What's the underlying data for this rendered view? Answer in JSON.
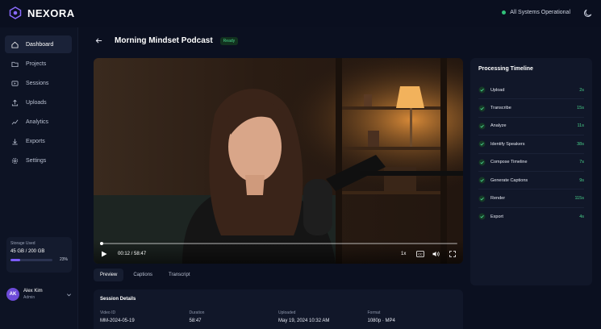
{
  "app": {
    "name": "NEXORA"
  },
  "system_status": "All Systems Operational",
  "sidebar": {
    "items": [
      {
        "label": "Dashboard",
        "icon": "home-icon",
        "active": true
      },
      {
        "label": "Projects",
        "icon": "folder-icon",
        "active": false
      },
      {
        "label": "Sessions",
        "icon": "video-icon",
        "active": false
      },
      {
        "label": "Uploads",
        "icon": "upload-icon",
        "active": false
      },
      {
        "label": "Analytics",
        "icon": "analytics-icon",
        "active": false
      },
      {
        "label": "Exports",
        "icon": "export-icon",
        "active": false
      },
      {
        "label": "Settings",
        "icon": "gear-icon",
        "active": false
      }
    ],
    "storage": {
      "label": "Storage Used",
      "value": "45 GB / 200 GB",
      "percent_text": "23%",
      "percent": 23
    },
    "user": {
      "initials": "AK",
      "name": "Alex Kim",
      "role": "Admin"
    }
  },
  "page": {
    "title": "Morning Mindset Podcast",
    "status": "Ready"
  },
  "player": {
    "time": "00:12 / 58:47",
    "speed": "1x",
    "progress": 0.4
  },
  "tabs": [
    {
      "label": "Preview",
      "active": true
    },
    {
      "label": "Captions",
      "active": false
    },
    {
      "label": "Transcript",
      "active": false
    }
  ],
  "details": {
    "title": "Session Details",
    "fields": [
      {
        "label": "Video ID",
        "value": "MM-2024-05-19"
      },
      {
        "label": "Duration",
        "value": "58:47"
      },
      {
        "label": "Uploaded",
        "value": "May 19, 2024 10:32 AM"
      },
      {
        "label": "Format",
        "value": "1080p · MP4"
      }
    ]
  },
  "timeline": {
    "title": "Processing Timeline",
    "steps": [
      {
        "label": "Upload",
        "time": "2s"
      },
      {
        "label": "Transcribe",
        "time": "15s"
      },
      {
        "label": "Analyze",
        "time": "11s"
      },
      {
        "label": "Identify Speakers",
        "time": "38s"
      },
      {
        "label": "Compose Timeline",
        "time": "7s"
      },
      {
        "label": "Generate Captions",
        "time": "9s"
      },
      {
        "label": "Render",
        "time": "115s"
      },
      {
        "label": "Export",
        "time": "4s"
      }
    ]
  },
  "colors": {
    "accent": "#7c5cff",
    "success": "#49d28b",
    "background": "#0b1020"
  }
}
